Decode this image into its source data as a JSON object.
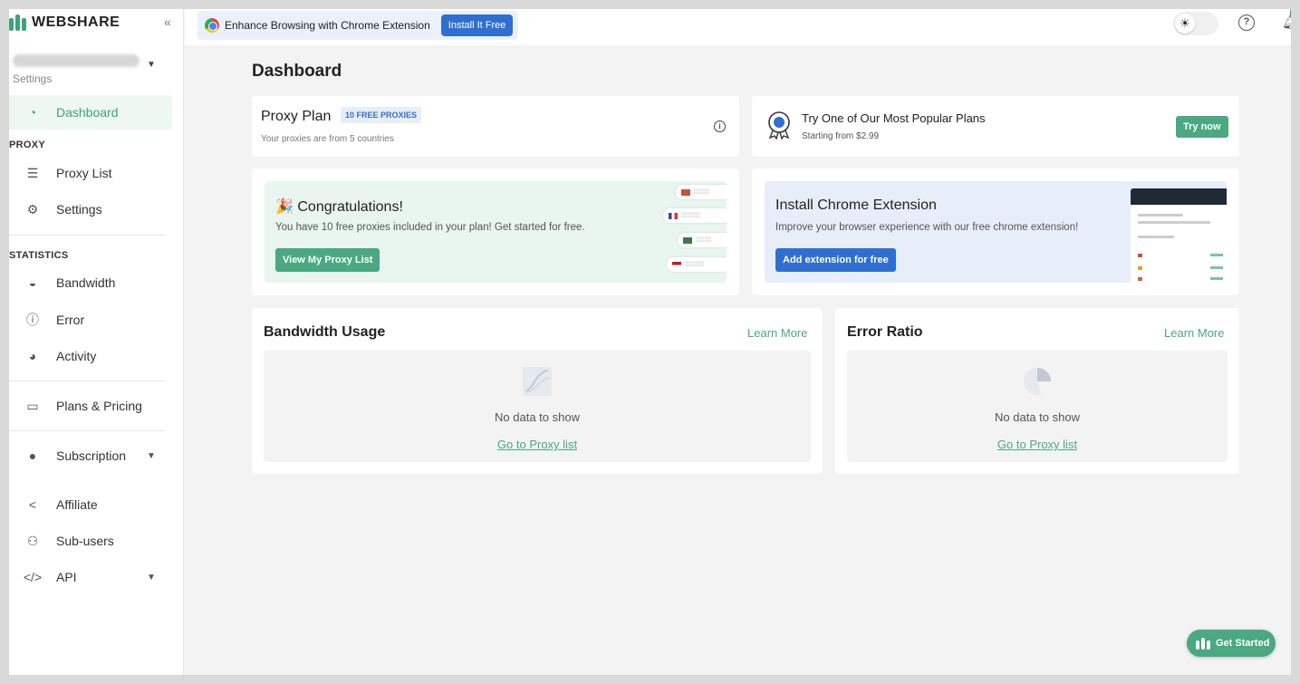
{
  "brand": {
    "name": "WEBSHARE",
    "color": "#3aa57a"
  },
  "sidebar": {
    "account_sub": "Settings",
    "items": [
      {
        "label": "Dashboard",
        "icon": "gauge-icon",
        "active": true
      },
      {
        "label": "Proxy List",
        "icon": "list-icon"
      },
      {
        "label": "Settings",
        "icon": "gear-icon"
      },
      {
        "label": "Bandwidth",
        "icon": "speedometer-icon"
      },
      {
        "label": "Error",
        "icon": "alert-icon"
      },
      {
        "label": "Activity",
        "icon": "pie-chart-icon"
      },
      {
        "label": "Plans & Pricing",
        "icon": "credit-card-icon"
      },
      {
        "label": "Subscription",
        "icon": "user-icon"
      },
      {
        "label": "Affiliate",
        "icon": "share-icon"
      },
      {
        "label": "Sub-users",
        "icon": "users-gear-icon"
      },
      {
        "label": "API",
        "icon": "code-icon"
      }
    ],
    "sections": {
      "proxy": "PROXY",
      "statistics": "STATISTICS"
    }
  },
  "topbar": {
    "banner_text": "Enhance Browsing with Chrome Extension",
    "install_label": "Install It Free"
  },
  "main": {
    "title": "Dashboard",
    "plan": {
      "title": "Proxy Plan",
      "badge": "10 FREE PROXIES",
      "sub": "Your proxies are from 5 countries"
    },
    "popular": {
      "title": "Try One of Our Most Popular Plans",
      "sub": "Starting from $2.99",
      "button": "Try now"
    },
    "congrats": {
      "title": "Congratulations!",
      "text": "You have 10 free proxies included in your plan! Get started for free.",
      "button": "View My Proxy List",
      "bg": "#e9f5ef",
      "button_color": "#4aa883"
    },
    "chrome_ext": {
      "title": "Install Chrome Extension",
      "text": "Improve your browser experience with our free chrome extension!",
      "button": "Add extension for free",
      "bg": "#e8eef9",
      "button_color": "#2f6fd1"
    },
    "bandwidth": {
      "title": "Bandwidth Usage",
      "learn_more": "Learn More",
      "empty": "No data to show",
      "link": "Go to Proxy list"
    },
    "error_ratio": {
      "title": "Error Ratio",
      "learn_more": "Learn More",
      "empty": "No data to show",
      "link": "Go to Proxy list"
    }
  },
  "get_started": "Get Started"
}
